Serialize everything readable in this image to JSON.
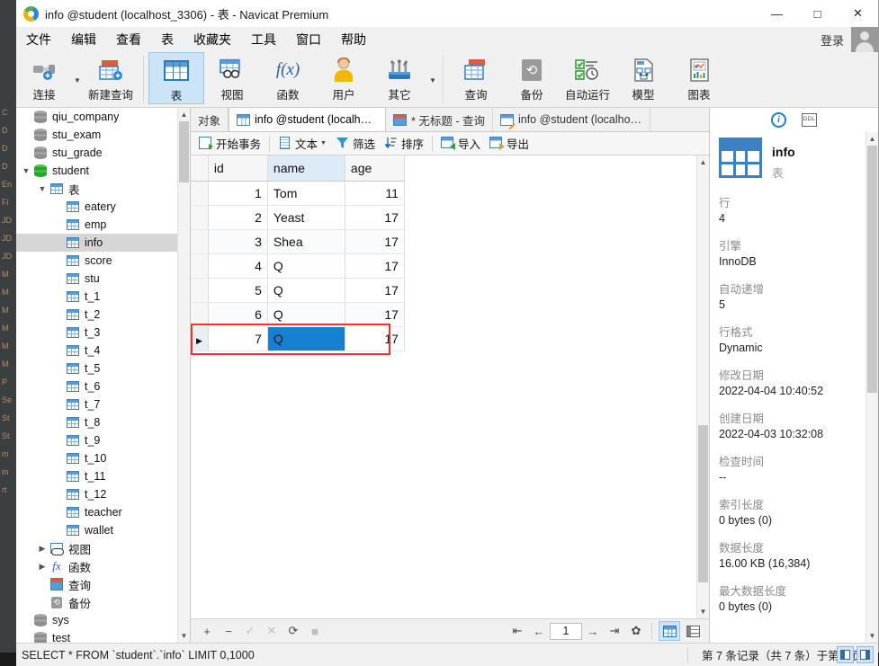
{
  "window": {
    "title": "info @student (localhost_3306) - 表 - Navicat Premium",
    "minimize": "—",
    "maximize": "□",
    "close": "✕"
  },
  "menubar": {
    "items": [
      "文件",
      "编辑",
      "查看",
      "表",
      "收藏夹",
      "工具",
      "窗口",
      "帮助"
    ],
    "login_label": "登录"
  },
  "toolbar": {
    "items": [
      {
        "label": "连接",
        "icon": "connection-icon",
        "has_caret": true
      },
      {
        "label": "新建查询",
        "icon": "new-query-icon",
        "has_caret": false
      },
      {
        "label": "表",
        "icon": "table-icon",
        "has_caret": false,
        "active": true
      },
      {
        "label": "视图",
        "icon": "view-icon",
        "has_caret": false
      },
      {
        "label": "函数",
        "icon": "function-icon",
        "has_caret": false
      },
      {
        "label": "用户",
        "icon": "user-icon",
        "has_caret": false
      },
      {
        "label": "其它",
        "icon": "other-tools-icon",
        "has_caret": true
      },
      {
        "label": "查询",
        "icon": "query-icon",
        "has_caret": false
      },
      {
        "label": "备份",
        "icon": "backup-icon",
        "has_caret": false
      },
      {
        "label": "自动运行",
        "icon": "automation-icon",
        "has_caret": false
      },
      {
        "label": "模型",
        "icon": "model-icon",
        "has_caret": false
      },
      {
        "label": "图表",
        "icon": "chart-icon",
        "has_caret": false
      }
    ]
  },
  "tree": {
    "items": [
      {
        "label": "qiu_company",
        "icon": "database-icon",
        "indent": 1,
        "twisty": "",
        "selected": false
      },
      {
        "label": "stu_exam",
        "icon": "database-icon",
        "indent": 1,
        "twisty": "",
        "selected": false
      },
      {
        "label": "stu_grade",
        "icon": "database-icon",
        "indent": 1,
        "twisty": "",
        "selected": false
      },
      {
        "label": "student",
        "icon": "database-icon-active",
        "indent": 1,
        "twisty": "expanded",
        "selected": false
      },
      {
        "label": "表",
        "icon": "table-folder-icon",
        "indent": 2,
        "twisty": "expanded",
        "selected": false
      },
      {
        "label": "eatery",
        "icon": "table-icon",
        "indent": 3,
        "twisty": "",
        "selected": false
      },
      {
        "label": "emp",
        "icon": "table-icon",
        "indent": 3,
        "twisty": "",
        "selected": false
      },
      {
        "label": "info",
        "icon": "table-icon",
        "indent": 3,
        "twisty": "",
        "selected": true
      },
      {
        "label": "score",
        "icon": "table-icon",
        "indent": 3,
        "twisty": "",
        "selected": false
      },
      {
        "label": "stu",
        "icon": "table-icon",
        "indent": 3,
        "twisty": "",
        "selected": false
      },
      {
        "label": "t_1",
        "icon": "table-icon",
        "indent": 3,
        "twisty": "",
        "selected": false
      },
      {
        "label": "t_2",
        "icon": "table-icon",
        "indent": 3,
        "twisty": "",
        "selected": false
      },
      {
        "label": "t_3",
        "icon": "table-icon",
        "indent": 3,
        "twisty": "",
        "selected": false
      },
      {
        "label": "t_4",
        "icon": "table-icon",
        "indent": 3,
        "twisty": "",
        "selected": false
      },
      {
        "label": "t_5",
        "icon": "table-icon",
        "indent": 3,
        "twisty": "",
        "selected": false
      },
      {
        "label": "t_6",
        "icon": "table-icon",
        "indent": 3,
        "twisty": "",
        "selected": false
      },
      {
        "label": "t_7",
        "icon": "table-icon",
        "indent": 3,
        "twisty": "",
        "selected": false
      },
      {
        "label": "t_8",
        "icon": "table-icon",
        "indent": 3,
        "twisty": "",
        "selected": false
      },
      {
        "label": "t_9",
        "icon": "table-icon",
        "indent": 3,
        "twisty": "",
        "selected": false
      },
      {
        "label": "t_10",
        "icon": "table-icon",
        "indent": 3,
        "twisty": "",
        "selected": false
      },
      {
        "label": "t_11",
        "icon": "table-icon",
        "indent": 3,
        "twisty": "",
        "selected": false
      },
      {
        "label": "t_12",
        "icon": "table-icon",
        "indent": 3,
        "twisty": "",
        "selected": false
      },
      {
        "label": "teacher",
        "icon": "table-icon",
        "indent": 3,
        "twisty": "",
        "selected": false
      },
      {
        "label": "wallet",
        "icon": "table-icon",
        "indent": 3,
        "twisty": "",
        "selected": false
      },
      {
        "label": "视图",
        "icon": "view-folder-icon",
        "indent": 2,
        "twisty": "collapsed",
        "selected": false
      },
      {
        "label": "函数",
        "icon": "function-folder-icon",
        "indent": 2,
        "twisty": "collapsed",
        "selected": false
      },
      {
        "label": "查询",
        "icon": "query-folder-icon",
        "indent": 2,
        "twisty": "",
        "selected": false
      },
      {
        "label": "备份",
        "icon": "backup-folder-icon",
        "indent": 2,
        "twisty": "",
        "selected": false
      },
      {
        "label": "sys",
        "icon": "database-icon",
        "indent": 1,
        "twisty": "",
        "selected": false
      },
      {
        "label": "test",
        "icon": "database-icon",
        "indent": 1,
        "twisty": "",
        "selected": false
      }
    ]
  },
  "tabs": [
    {
      "label": "对象",
      "icon": "",
      "active": false
    },
    {
      "label": "info @student (localhos...",
      "icon": "table-grid-icon",
      "active": true
    },
    {
      "label": "* 无标题 - 查询",
      "icon": "query-tab-icon",
      "active": false
    },
    {
      "label": "info @student (localhos...",
      "icon": "design-tab-icon",
      "active": false
    }
  ],
  "subtoolbar": {
    "items": [
      {
        "label": "开始事务",
        "icon": "begin-transaction-icon",
        "caret": false
      },
      {
        "label": "文本",
        "icon": "text-icon",
        "caret": true
      },
      {
        "label": "筛选",
        "icon": "filter-icon",
        "caret": false
      },
      {
        "label": "排序",
        "icon": "sort-icon",
        "caret": false
      },
      {
        "label": "导入",
        "icon": "import-icon",
        "caret": false
      },
      {
        "label": "导出",
        "icon": "export-icon",
        "caret": false
      }
    ]
  },
  "grid": {
    "columns": [
      "id",
      "name",
      "age"
    ],
    "active_column": "name",
    "rows": [
      {
        "id": "1",
        "name": "Tom",
        "age": "11"
      },
      {
        "id": "2",
        "name": "Yeast",
        "age": "17"
      },
      {
        "id": "3",
        "name": "Shea",
        "age": "17"
      },
      {
        "id": "4",
        "name": "Q",
        "age": "17"
      },
      {
        "id": "5",
        "name": "Q",
        "age": "17"
      },
      {
        "id": "6",
        "name": "Q",
        "age": "17"
      },
      {
        "id": "7",
        "name": "Q",
        "age": "17"
      }
    ],
    "current_row_index": 6,
    "selected_cell": {
      "row": 6,
      "column": "name",
      "value": "Q"
    },
    "row_marker": "▶",
    "annotation_color": "#e8342a"
  },
  "gridnav": {
    "add": "+",
    "remove": "−",
    "confirm": "✓",
    "cancel": "✕",
    "refresh": "⟳",
    "stop": "■",
    "first": "⇤",
    "prev": "←",
    "page": "1",
    "next": "→",
    "last": "⇥",
    "settings": "✿",
    "grid_view": "grid-view-icon",
    "form_view": "form-view-icon"
  },
  "info_panel": {
    "info_button": "i",
    "ddl_button": "DDL",
    "object_name": "info",
    "object_type": "表",
    "fields": [
      {
        "key": "行",
        "value": "4"
      },
      {
        "key": "引擎",
        "value": "InnoDB"
      },
      {
        "key": "自动递增",
        "value": "5"
      },
      {
        "key": "行格式",
        "value": "Dynamic"
      },
      {
        "key": "修改日期",
        "value": "2022-04-04 10:40:52"
      },
      {
        "key": "创建日期",
        "value": "2022-04-03 10:32:08"
      },
      {
        "key": "检查时间",
        "value": "--"
      },
      {
        "key": "索引长度",
        "value": "0 bytes (0)"
      },
      {
        "key": "数据长度",
        "value": "16.00 KB (16,384)"
      },
      {
        "key": "最大数据长度",
        "value": "0 bytes (0)"
      }
    ]
  },
  "statusbar": {
    "sql": "SELECT * FROM `student`.`info` LIMIT 0,1000",
    "record_info": "第 7 条记录（共 7 条）于第 1 页"
  },
  "background_window": {
    "rows": [
      "C",
      "D",
      "D",
      "D",
      "En",
      "Fi",
      "JD",
      "JD",
      "JD",
      "M",
      "M",
      "M",
      "M",
      "M",
      "M",
      "P",
      "Se",
      "St",
      "St",
      "m",
      "m",
      "rt"
    ]
  },
  "colors": {
    "accent": "#1680d2",
    "toolbar_active": "#cce4f7",
    "annotation": "#e8342a",
    "tree_selected": "#d6d6d6"
  }
}
